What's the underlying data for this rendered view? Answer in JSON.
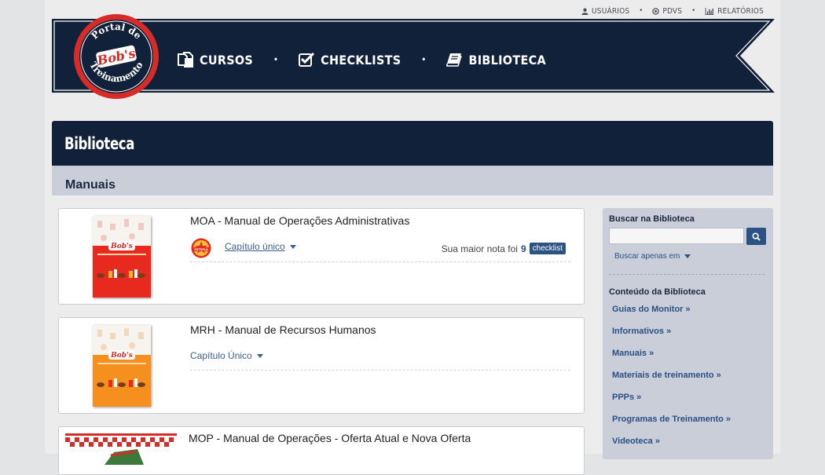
{
  "util_nav": {
    "users": "USUÁRIOS",
    "pdvs": "PDVS",
    "reports": "RELATÓRIOS",
    "user_icon": "user-icon",
    "pdv_icon": "target-icon",
    "report_icon": "bar-chart-icon"
  },
  "logo": {
    "top_text": "Portal de",
    "brand": "Bob's",
    "bottom_text": "Treinamento"
  },
  "main_nav": {
    "courses": "CURSOS",
    "checklists": "CHECKLISTS",
    "library": "BIBLIOTECA",
    "courses_icon": "document-copy-icon",
    "checklists_icon": "checkbox-icon",
    "library_icon": "book-icon"
  },
  "page_title": "Biblioteca",
  "section_title": "Manuais",
  "cards": [
    {
      "title": "MOA - Manual de Operações Administrativas",
      "chapter": "Capítulo único",
      "score_prefix": "Sua maior nota foi",
      "score_value": "9",
      "badge": "checklist",
      "medal_text": "ESTRELA",
      "cover_color": "#e8291f"
    },
    {
      "title": "MRH - Manual de Recursos Humanos",
      "chapter": "Capítulo Único",
      "cover_color": "#f5901e"
    },
    {
      "title": "MOP - Manual de Operações - Oferta Atual e Nova Oferta"
    }
  ],
  "sidebar": {
    "search_label": "Buscar na Biblioteca",
    "search_value": "",
    "only_in": "Buscar apenas em",
    "content_label": "Conteúdo da Biblioteca",
    "links": [
      "Guias do Monitor »",
      "Informativos »",
      "Manuais »",
      "Materiais de treinamento »",
      "PPPs »",
      "Programas de Treinamento »",
      "Videoteca »"
    ]
  },
  "colors": {
    "navy": "#12213a",
    "logo_red": "#d62b26",
    "link_blue": "#2a4f86",
    "sidebar_bg": "#c9ced8"
  }
}
